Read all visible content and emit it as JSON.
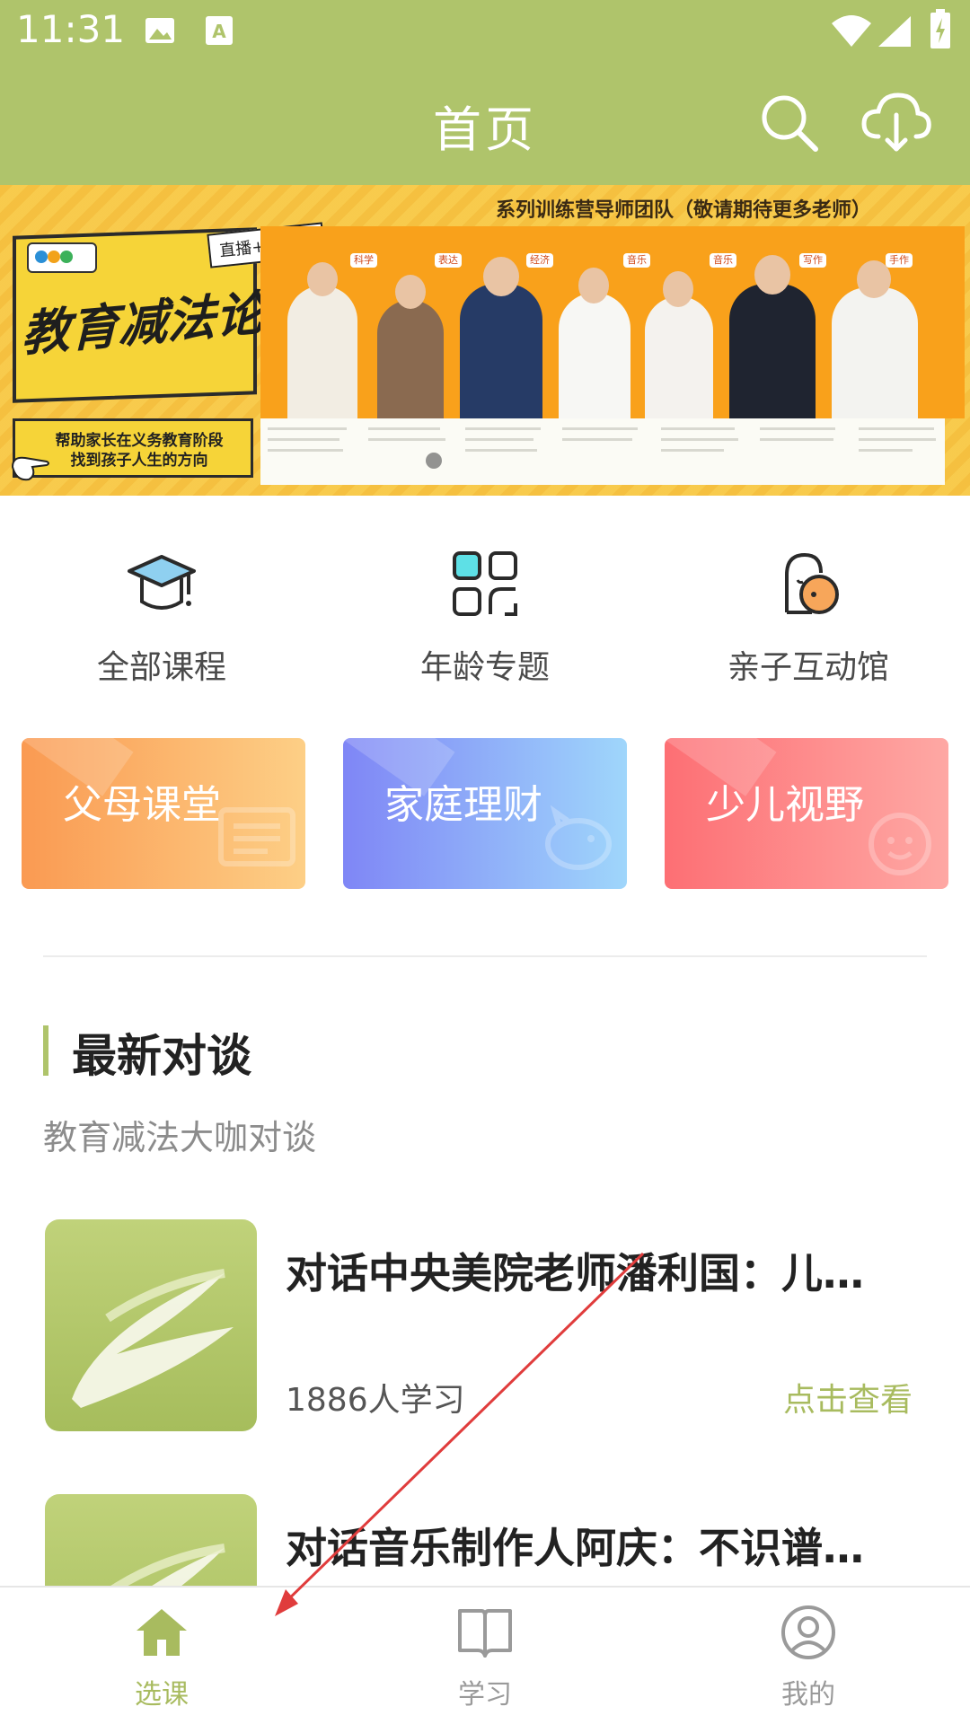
{
  "status_bar": {
    "time": "11:31"
  },
  "header": {
    "title": "首页",
    "search_icon": "search-icon",
    "download_icon": "cloud-download-icon"
  },
  "banner": {
    "top_text": "系列训练营导师团队（敬请期待更多老师）",
    "title": "教育减法论",
    "tag": "直播+训练营",
    "subtitle_line1": "帮助家长在义务教育阶段",
    "subtitle_line2": "找到孩子人生的方向",
    "subjects": [
      "科学",
      "表达",
      "经济",
      "音乐",
      "音乐",
      "写作",
      "手作"
    ]
  },
  "menu": {
    "items": [
      {
        "label": "全部课程",
        "icon": "graduation-cap-icon"
      },
      {
        "label": "年龄专题",
        "icon": "grid-icon"
      },
      {
        "label": "亲子互动馆",
        "icon": "parent-child-icon"
      }
    ]
  },
  "cards": [
    {
      "label": "父母课堂",
      "icon": "screen-icon"
    },
    {
      "label": "家庭理财",
      "icon": "piggy-bank-icon"
    },
    {
      "label": "少儿视野",
      "icon": "kid-face-icon"
    }
  ],
  "section": {
    "title": "最新对谈",
    "subtitle": "教育减法大咖对谈"
  },
  "list": [
    {
      "title": "对话中央美院老师潘利国：儿…",
      "count": "1886人学习",
      "link": "点击查看"
    },
    {
      "title": "对话音乐制作人阿庆：不识谱…"
    }
  ],
  "tabs": [
    {
      "label": "选课",
      "icon": "home-icon",
      "active": true
    },
    {
      "label": "学习",
      "icon": "book-icon",
      "active": false
    },
    {
      "label": "我的",
      "icon": "user-icon",
      "active": false
    }
  ],
  "colors": {
    "brand": "#afc46b",
    "active_tab": "#a8bb5f",
    "inactive_tab": "#9a9a9a",
    "arrow": "#e03c3c"
  }
}
